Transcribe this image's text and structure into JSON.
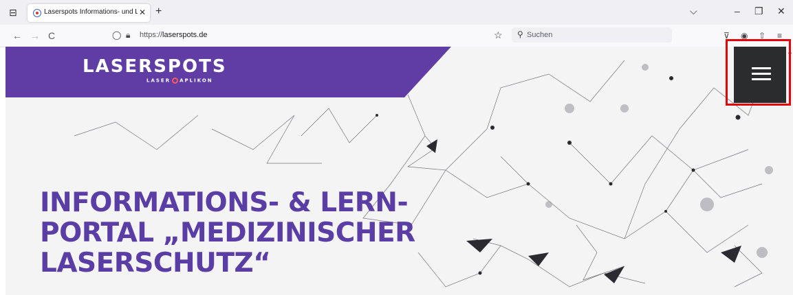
{
  "browser": {
    "tab": {
      "title": "Laserspots Informations- und Le",
      "close": "✕"
    },
    "new_tab": "+",
    "tab_list": "⊟",
    "window_controls": {
      "list": "⌵",
      "minimize": "–",
      "restore": "❐",
      "close": "✕"
    },
    "nav": {
      "back": "←",
      "forward": "→",
      "reload": "C"
    },
    "url": {
      "prefix": "https://",
      "host": "laserspots.de"
    },
    "search_placeholder": "Suchen",
    "icons": [
      "shield-icon",
      "lock-icon",
      "star-icon",
      "search-icon",
      "pocket-icon",
      "account-icon",
      "extensions-icon",
      "menu-icon"
    ]
  },
  "site": {
    "logo": {
      "main": "LASERSPOTS",
      "sub_left": "LASER",
      "sub_right": "APLIKON"
    },
    "headline": [
      "INFORMATIONS- & LERN-",
      "PORTAL „MEDIZINISCHER",
      "LASERSCHUTZ“"
    ],
    "colors": {
      "brand_purple": "#5f3da4",
      "headline": "#5a3ea6",
      "menu_button": "#2b2c2e",
      "highlight": "#e4050c"
    }
  }
}
